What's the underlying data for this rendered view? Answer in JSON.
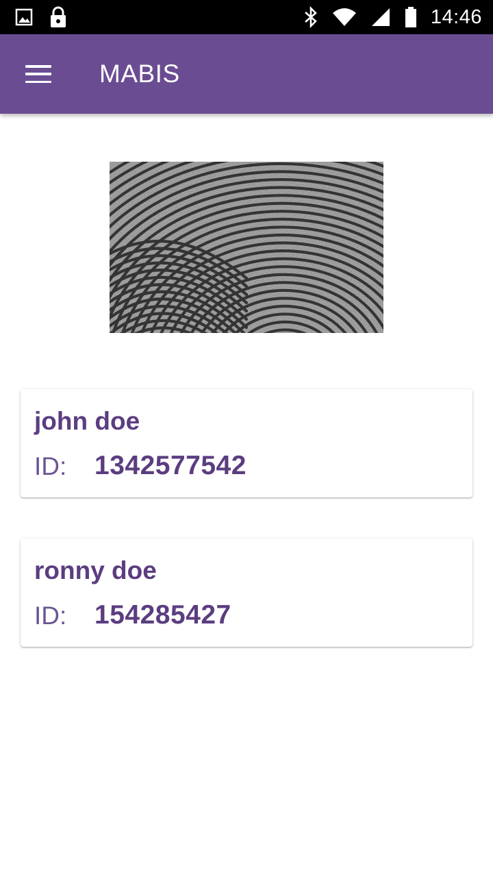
{
  "status_bar": {
    "time": "14:46",
    "icons": [
      "image-icon",
      "lock-icon",
      "bluetooth-icon",
      "wifi-icon",
      "cell-signal-icon",
      "battery-icon"
    ]
  },
  "app_bar": {
    "title": "MABIS",
    "menu_icon": "menu-icon"
  },
  "fingerprint": {
    "icon": "fingerprint-image"
  },
  "results": [
    {
      "name": "john doe",
      "id_label": "ID:",
      "id_value": "1342577542"
    },
    {
      "name": "ronny doe",
      "id_label": "ID:",
      "id_value": "154285427"
    }
  ],
  "colors": {
    "primary": "#6a4c93",
    "text_primary": "#5b3d80",
    "status_bar": "#000000",
    "background": "#ffffff"
  }
}
